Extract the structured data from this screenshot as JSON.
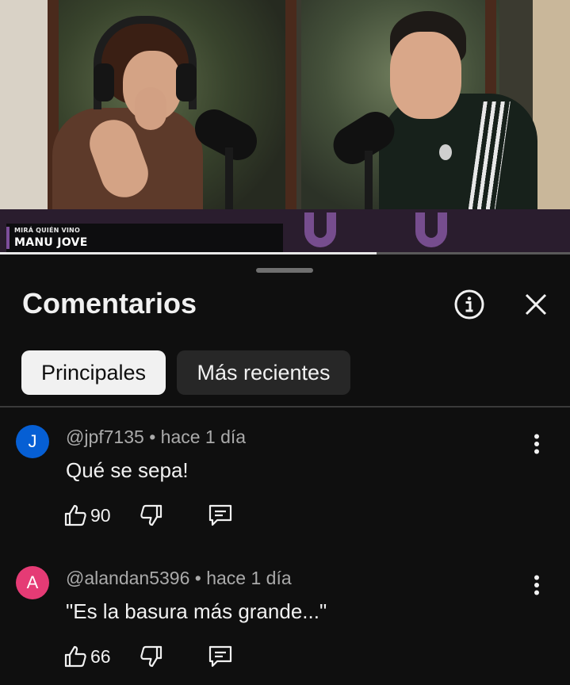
{
  "video": {
    "lower_third": {
      "kicker": "MIRÁ QUIÉN VINO",
      "name": "MANU JOVE"
    },
    "progress_fraction": 0.66
  },
  "comments_panel": {
    "title": "Comentarios",
    "info_icon": "info-icon",
    "close_icon": "close-icon",
    "filter_chips": [
      {
        "label": "Principales",
        "selected": true
      },
      {
        "label": "Más recientes",
        "selected": false
      }
    ],
    "comments": [
      {
        "avatar_letter": "J",
        "avatar_color": "#065fd4",
        "author": "@jpf7135",
        "time": "hace 1 día",
        "text": "Qué se sepa!",
        "likes": "90"
      },
      {
        "avatar_letter": "A",
        "avatar_color": "#e53b75",
        "author": "@alandan5396",
        "time": "hace 1 día",
        "text": "\"Es la basura más grande...\"",
        "likes": "66"
      }
    ]
  },
  "colors": {
    "background": "#0f0f0f",
    "text": "#f1f1f1",
    "secondary_text": "#aaaaaa",
    "chip_active_bg": "#f1f1f1",
    "chip_inactive_bg": "#272727",
    "accent_purple": "#7d4e9b"
  }
}
